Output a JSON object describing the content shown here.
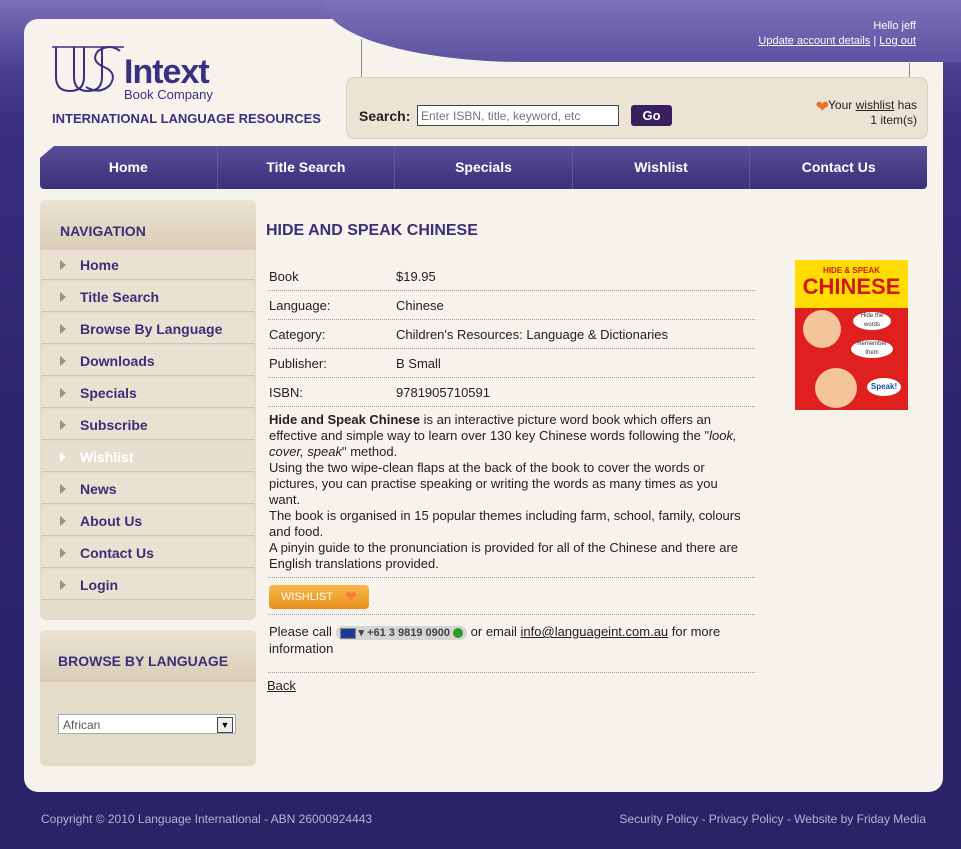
{
  "header": {
    "greeting": "Hello jeff",
    "update_account": "Update account details",
    "separator": "|",
    "logout": "Log out",
    "logo_name": "Intext",
    "logo_sub": "Book Company",
    "logo_tagline": "INTERNATIONAL LANGUAGE RESOURCES"
  },
  "search": {
    "label": "Search:",
    "placeholder": "Enter ISBN, title, keyword, etc",
    "button": "Go"
  },
  "wishlist_note": {
    "prefix": "Your",
    "link": "wishlist",
    "suffix": "has",
    "count": "1 item(s)"
  },
  "topnav": [
    "Home",
    "Title Search",
    "Specials",
    "Wishlist",
    "Contact Us"
  ],
  "sidebar": {
    "heading": "NAVIGATION",
    "items": [
      "Home",
      "Title Search",
      "Browse By Language",
      "Downloads",
      "Specials",
      "Subscribe",
      "Wishlist",
      "News",
      "About Us",
      "Contact Us",
      "Login"
    ]
  },
  "browse_language": {
    "heading": "BROWSE BY LANGUAGE",
    "selected": "African"
  },
  "product": {
    "title": "HIDE AND SPEAK CHINESE",
    "details": [
      {
        "k": "Book",
        "v": "$19.95"
      },
      {
        "k": "Language:",
        "v": "Chinese"
      },
      {
        "k": "Category:",
        "v": "Children's Resources: Language & Dictionaries"
      },
      {
        "k": "Publisher:",
        "v": "B Small"
      },
      {
        "k": "ISBN:",
        "v": "9781905710591"
      }
    ],
    "desc_bold": "Hide and Speak Chinese",
    "desc_1a": " is an interactive picture word book which offers an effective and simple way to learn over 130 key Chinese words following the \"",
    "desc_1i": "look, cover, speak",
    "desc_1b": "\" method.",
    "desc_2": "Using the two wipe-clean flaps at the back of the book to cover the words or pictures, you can practise speaking or writing the words as many times as you want.",
    "desc_3": "The book is organised in 15 popular themes including farm, school, family, colours and food.",
    "desc_4": "A pinyin guide to the pronunciation is provided for all of the Chinese and there are English translations provided.",
    "wishlist_btn": "WISHLIST",
    "contact_prefix": "Please call",
    "phone": "+61 3 9819 0900",
    "contact_mid": "or email",
    "email": "info@languageint.com.au",
    "contact_suffix": "for more information",
    "back": "Back",
    "cover_top": "HIDE & SPEAK",
    "cover_title": "CHINESE",
    "cover_bubble1": "Hide the words",
    "cover_bubble2": "Remember them",
    "cover_bubble3": "Speak!"
  },
  "footer": {
    "copyright": "Copyright © 2010 Language International - ABN 26000924443",
    "links": [
      "Security Policy",
      "Privacy Policy",
      "Website by Friday Media"
    ],
    "link_sep": " - "
  }
}
